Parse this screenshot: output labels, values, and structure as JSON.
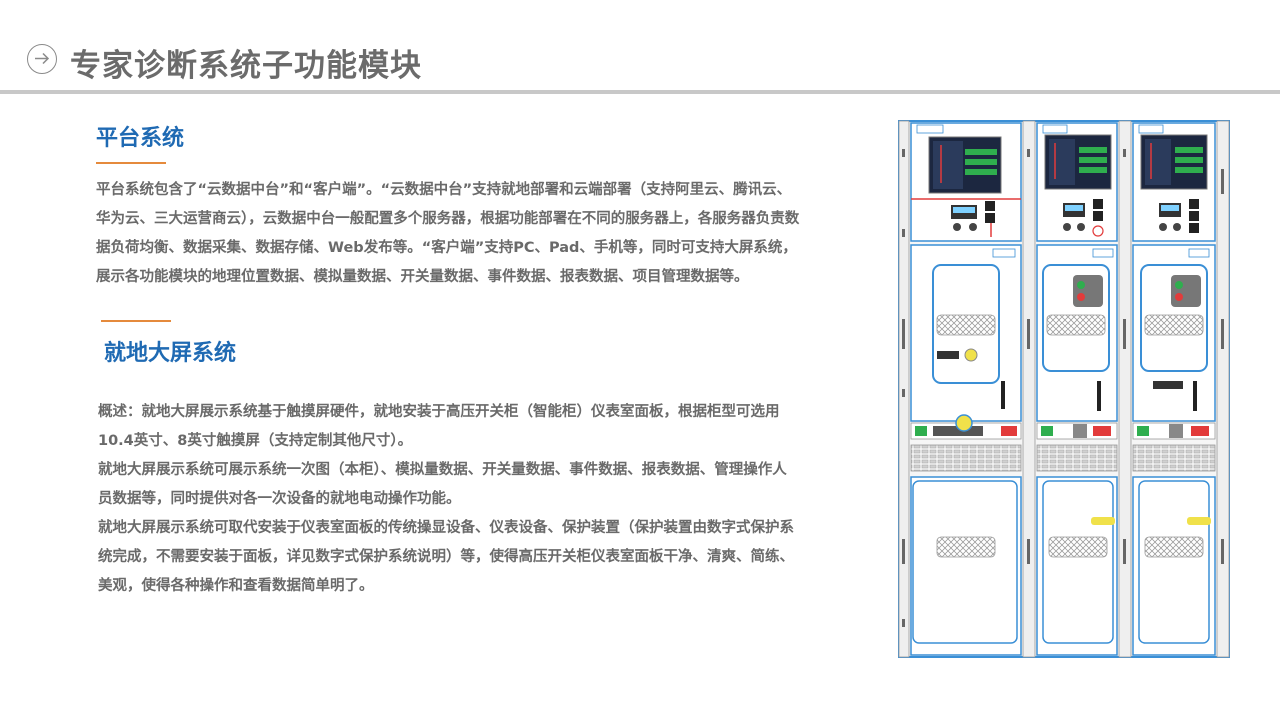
{
  "header": {
    "title": "专家诊断系统子功能模块",
    "icon": "arrow-right-circle-icon"
  },
  "platform_section": {
    "heading": "平台系统",
    "lines": [
      "平台系统包含了“云数据中台”和“客户端”。“云数据中台”支持就地部署和云端部署（支持阿里云、腾讯云、",
      "华为云、三大运营商云），云数据中台一般配置多个服务器，根据功能部署在不同的服务器上，各服务器负责数",
      "据负荷均衡、数据采集、数据存储、Web发布等。“客户端”支持PC、Pad、手机等，同时可支持大屏系统，",
      "展示各功能模块的地理位置数据、模拟量数据、开关量数据、事件数据、报表数据、项目管理数据等。"
    ]
  },
  "local_section": {
    "heading": "就地大屏系统",
    "lines": [
      "概述：就地大屏展示系统基于触摸屏硬件，就地安装于高压开关柜（智能柜）仪表室面板，根据柜型可选用",
      "10.4英寸、8英寸触摸屏（支持定制其他尺寸）。",
      "就地大屏展示系统可展示系统一次图（本柜）、模拟量数据、开关量数据、事件数据、报表数据、管理操作人",
      "员数据等，同时提供对各一次设备的就地电动操作功能。",
      "就地大屏展示系统可取代安装于仪表室面板的传统操显设备、仪表设备、保护装置（保护装置由数字式保护系",
      "统完成，不需要安装于面板，详见数字式保护系统说明）等，使得高压开关柜仪表室面板干净、清爽、简练、",
      "美观，使得各种操作和查看数据简单明了。"
    ]
  },
  "colors": {
    "heading": "#1f6ab3",
    "accent": "#e58a3c",
    "body_text": "#6a6a6a",
    "title_text": "#6b6b6b",
    "rule": "#c8c8c8",
    "cabinet_outline": "#3a8fd6"
  }
}
